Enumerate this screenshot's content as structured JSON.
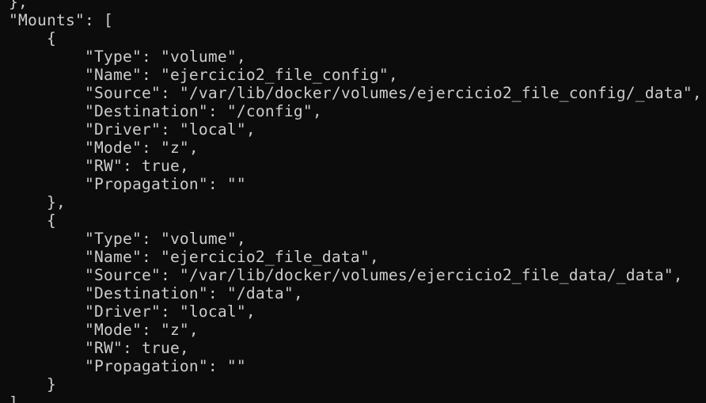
{
  "terminal": {
    "lines": [
      "},",
      "\"Mounts\": [",
      "    {",
      "        \"Type\": \"volume\",",
      "        \"Name\": \"ejercicio2_file_config\",",
      "        \"Source\": \"/var/lib/docker/volumes/ejercicio2_file_config/_data\",",
      "        \"Destination\": \"/config\",",
      "        \"Driver\": \"local\",",
      "        \"Mode\": \"z\",",
      "        \"RW\": true,",
      "        \"Propagation\": \"\"",
      "    },",
      "    {",
      "        \"Type\": \"volume\",",
      "        \"Name\": \"ejercicio2_file_data\",",
      "        \"Source\": \"/var/lib/docker/volumes/ejercicio2_file_data/_data\",",
      "        \"Destination\": \"/data\",",
      "        \"Driver\": \"local\",",
      "        \"Mode\": \"z\",",
      "        \"RW\": true,",
      "        \"Propagation\": \"\"",
      "    }",
      "],"
    ]
  }
}
